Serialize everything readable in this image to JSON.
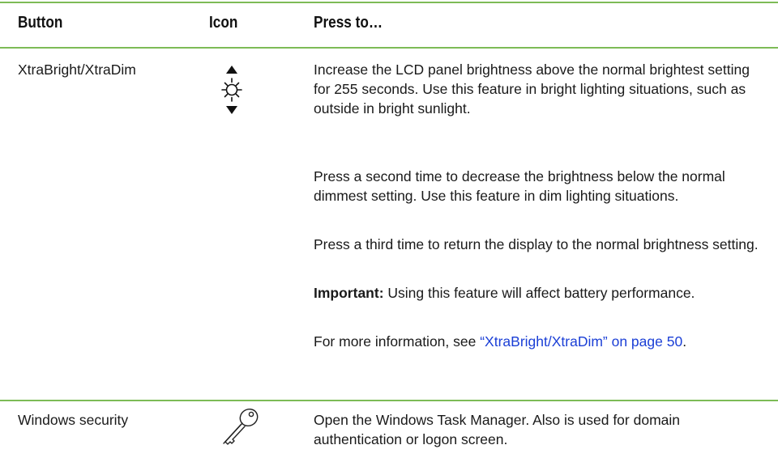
{
  "table": {
    "headers": {
      "button": "Button",
      "icon": "Icon",
      "press": "Press to…"
    },
    "rows": [
      {
        "button": "XtraBright/XtraDim",
        "icon": "brightness-up-down-icon",
        "description": [
          "Increase the LCD panel brightness above the normal brightest setting for 255 seconds. Use this feature in bright lighting situations, such as outside in bright sunlight.",
          "Press a second time to decrease the brightness below the normal dimmest setting. Use this feature in dim lighting situations.",
          "Press a third time to return the display to the normal brightness setting."
        ],
        "important_label": "Important:",
        "important_text": " Using this feature will affect battery performance.",
        "more_info_prefix": "For more information, see ",
        "more_info_link": "“XtraBright/XtraDim” on page 50",
        "more_info_suffix": "."
      },
      {
        "button": "Windows security",
        "icon": "key-icon",
        "description": [
          "Open the Windows Task Manager. Also is used for domain authentication or logon screen."
        ]
      }
    ]
  },
  "colors": {
    "rule": "#7dbb56",
    "link": "#1b3fd6"
  }
}
